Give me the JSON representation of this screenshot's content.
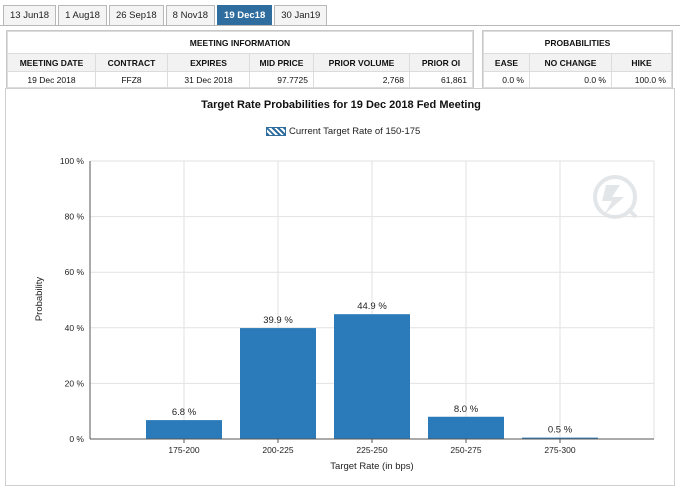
{
  "tabs": [
    {
      "label": "13 Jun18",
      "active": false
    },
    {
      "label": "1 Aug18",
      "active": false
    },
    {
      "label": "26 Sep18",
      "active": false
    },
    {
      "label": "8 Nov18",
      "active": false
    },
    {
      "label": "19 Dec18",
      "active": true
    },
    {
      "label": "30 Jan19",
      "active": false
    }
  ],
  "meeting_info": {
    "title": "MEETING INFORMATION",
    "headers": {
      "meeting_date": "MEETING DATE",
      "contract": "CONTRACT",
      "expires": "EXPIRES",
      "mid_price": "MID PRICE",
      "prior_volume": "PRIOR VOLUME",
      "prior_oi": "PRIOR OI"
    },
    "values": {
      "meeting_date": "19 Dec 2018",
      "contract": "FFZ8",
      "expires": "31 Dec 2018",
      "mid_price": "97.7725",
      "prior_volume": "2,768",
      "prior_oi": "61,861"
    }
  },
  "probabilities": {
    "title": "PROBABILITIES",
    "headers": {
      "ease": "EASE",
      "no_change": "NO CHANGE",
      "hike": "HIKE"
    },
    "values": {
      "ease": "0.0 %",
      "no_change": "0.0 %",
      "hike": "100.0 %"
    }
  },
  "chart_data": {
    "type": "bar",
    "title": "Target Rate Probabilities for 19 Dec 2018 Fed Meeting",
    "legend": "Current Target Rate of 150-175",
    "xlabel": "Target Rate (in bps)",
    "ylabel": "Probability",
    "categories": [
      "175-200",
      "200-225",
      "225-250",
      "250-275",
      "275-300"
    ],
    "values": [
      6.8,
      39.9,
      44.9,
      8.0,
      0.5
    ],
    "value_labels": [
      "6.8 %",
      "39.9 %",
      "44.9 %",
      "8.0 %",
      "0.5 %"
    ],
    "ylim": [
      0,
      100
    ],
    "yticks": [
      "0 %",
      "20 %",
      "40 %",
      "60 %",
      "80 %",
      "100 %"
    ],
    "grid": true,
    "bar_color": "#2b7bba"
  }
}
